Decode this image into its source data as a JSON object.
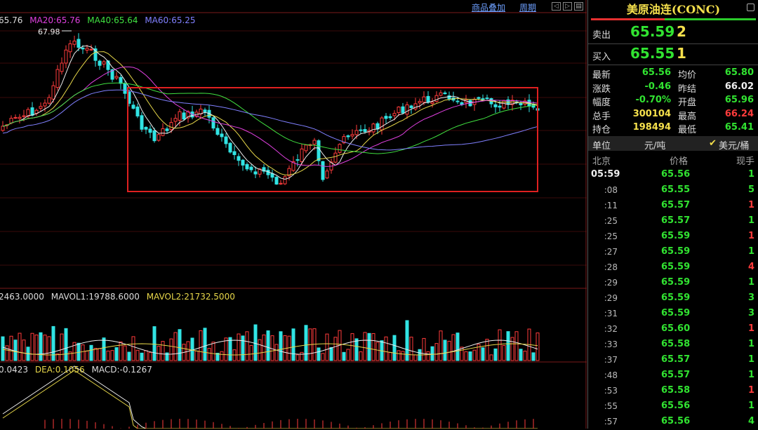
{
  "toolbar": {
    "overlay_link": "商品叠加",
    "period_link": "周期",
    "scroll_left": "◁",
    "scroll_right": "▷",
    "scroll_end": "▤"
  },
  "price_panel": {
    "ma_labels": [
      {
        "text": "65.76",
        "color": "#dddddd"
      },
      {
        "text": "MA20:65.76",
        "color": "#e040e0"
      },
      {
        "text": "MA40:65.64",
        "color": "#40e040"
      },
      {
        "text": "MA60:65.25",
        "color": "#8080ff"
      }
    ],
    "high_marker": "67.98"
  },
  "volume_panel": {
    "labels": [
      {
        "text": "2463.0000",
        "color": "#dddddd"
      },
      {
        "text": "MAVOL1:19788.6000",
        "color": "#dddddd"
      },
      {
        "text": "MAVOL2:21732.5000",
        "color": "#e8d84a"
      }
    ]
  },
  "macd_panel": {
    "labels": [
      {
        "text": "0.0423",
        "color": "#dddddd"
      },
      {
        "text": "DEA:0.1056",
        "color": "#e8d84a"
      },
      {
        "text": "MACD:-0.1267",
        "color": "#dddddd"
      }
    ]
  },
  "quote": {
    "title": "美原油连(CONC)",
    "ask": {
      "label": "卖出",
      "price": "65.59",
      "qty": "2"
    },
    "bid": {
      "label": "买入",
      "price": "65.55",
      "qty": "1"
    },
    "stats": [
      {
        "k1": "最新",
        "v1": "65.56",
        "c1": "#31e331",
        "k2": "均价",
        "v2": "65.80",
        "c2": "#31e331"
      },
      {
        "k1": "涨跌",
        "v1": "-0.46",
        "c1": "#31e331",
        "k2": "昨结",
        "v2": "66.02",
        "c2": "#eeeeee"
      },
      {
        "k1": "幅度",
        "v1": "-0.70%",
        "c1": "#31e331",
        "k2": "开盘",
        "v2": "65.96",
        "c2": "#31e331"
      },
      {
        "k1": "总手",
        "v1": "300104",
        "c1": "#f5e04c",
        "k2": "最高",
        "v2": "66.24",
        "c2": "#ff3b3b"
      },
      {
        "k1": "持仓",
        "v1": "198494",
        "c1": "#f5e04c",
        "k2": "最低",
        "v2": "65.41",
        "c2": "#31e331"
      }
    ],
    "unit": {
      "label": "单位",
      "value": "元/吨",
      "check": "✔",
      "selected": "美元/桶"
    },
    "tick_header": {
      "time": "北京",
      "price": "价格",
      "qty": "现手"
    },
    "ticks": [
      {
        "time": "05:59",
        "price": "65.56",
        "qty": "1",
        "pc": "#31e331",
        "qc": "#31e331"
      },
      {
        "time": ":08",
        "price": "65.55",
        "qty": "5",
        "pc": "#31e331",
        "qc": "#31e331"
      },
      {
        "time": ":11",
        "price": "65.57",
        "qty": "1",
        "pc": "#31e331",
        "qc": "#ff3b3b"
      },
      {
        "time": ":25",
        "price": "65.57",
        "qty": "1",
        "pc": "#31e331",
        "qc": "#31e331"
      },
      {
        "time": ":25",
        "price": "65.59",
        "qty": "1",
        "pc": "#31e331",
        "qc": "#ff3b3b"
      },
      {
        "time": ":27",
        "price": "65.59",
        "qty": "1",
        "pc": "#31e331",
        "qc": "#31e331"
      },
      {
        "time": ":28",
        "price": "65.59",
        "qty": "4",
        "pc": "#31e331",
        "qc": "#ff3b3b"
      },
      {
        "time": ":29",
        "price": "65.59",
        "qty": "1",
        "pc": "#31e331",
        "qc": "#31e331"
      },
      {
        "time": ":29",
        "price": "65.59",
        "qty": "3",
        "pc": "#31e331",
        "qc": "#31e331"
      },
      {
        "time": ":31",
        "price": "65.59",
        "qty": "3",
        "pc": "#31e331",
        "qc": "#31e331"
      },
      {
        "time": ":32",
        "price": "65.60",
        "qty": "1",
        "pc": "#31e331",
        "qc": "#ff3b3b"
      },
      {
        "time": ":33",
        "price": "65.58",
        "qty": "1",
        "pc": "#31e331",
        "qc": "#31e331"
      },
      {
        "time": ":37",
        "price": "65.57",
        "qty": "1",
        "pc": "#31e331",
        "qc": "#31e331"
      },
      {
        "time": ":48",
        "price": "65.57",
        "qty": "1",
        "pc": "#31e331",
        "qc": "#31e331"
      },
      {
        "time": ":53",
        "price": "65.58",
        "qty": "1",
        "pc": "#31e331",
        "qc": "#ff3b3b"
      },
      {
        "time": ":55",
        "price": "65.56",
        "qty": "1",
        "pc": "#31e331",
        "qc": "#31e331"
      },
      {
        "time": ":57",
        "price": "65.56",
        "qty": "4",
        "pc": "#31e331",
        "qc": "#31e331"
      }
    ]
  },
  "colors": {
    "up": "#ff3b3b",
    "down": "#31e3e3",
    "ma5": "#eeeeee",
    "ma10": "#e8d84a",
    "ma20": "#e040e0",
    "ma40": "#40e040",
    "ma60": "#8080ff",
    "highlight_box": "#e02020"
  }
}
